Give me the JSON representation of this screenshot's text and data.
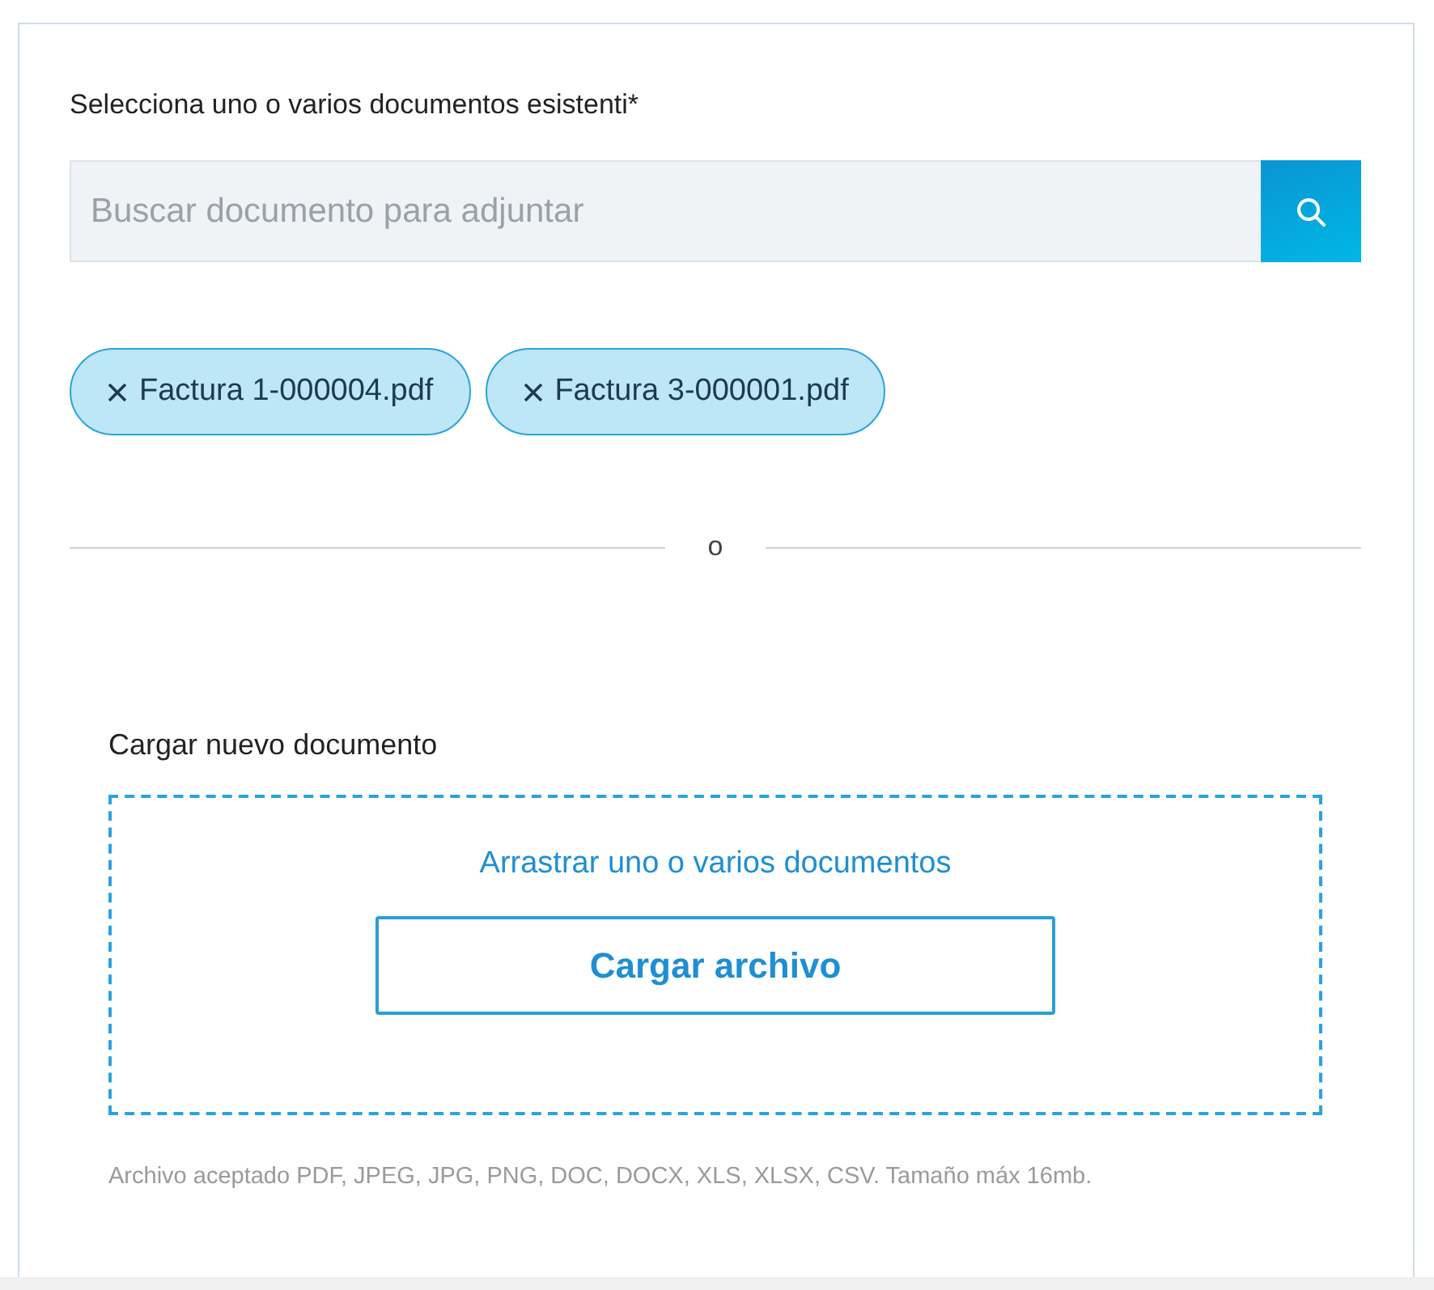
{
  "existing_documents": {
    "label": "Selecciona uno o varios documentos esistenti*",
    "search": {
      "placeholder": "Buscar documento para adjuntar"
    },
    "selected_files": [
      {
        "name": "Factura 1-000004.pdf"
      },
      {
        "name": "Factura 3-000001.pdf"
      }
    ]
  },
  "divider_text": "o",
  "upload": {
    "title": "Cargar nuevo documento",
    "drop_hint": "Arrastrar uno o varios documentos",
    "button": "Cargar archivo",
    "note": "Archivo aceptado PDF, JPEG, JPG, PNG, DOC, DOCX, XLS, XLSX, CSV. Tamaño máx 16mb."
  }
}
